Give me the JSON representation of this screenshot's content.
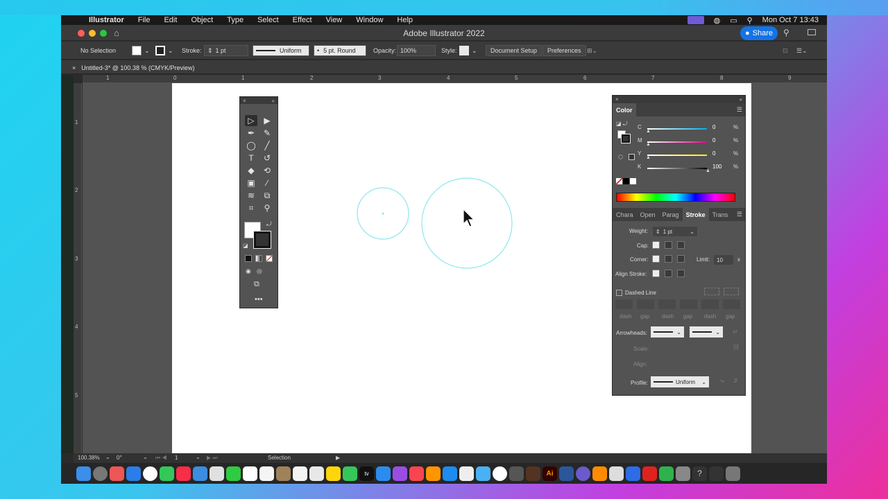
{
  "menubar": {
    "app": "Illustrator",
    "items": [
      "File",
      "Edit",
      "Object",
      "Type",
      "Select",
      "Effect",
      "View",
      "Window",
      "Help"
    ],
    "clock": "Mon Oct 7  13:43"
  },
  "window": {
    "title": "Adobe Illustrator 2022",
    "share": "Share"
  },
  "control": {
    "selection": "No Selection",
    "stroke_label": "Stroke:",
    "stroke_weight": "1 pt",
    "profile": "Uniform",
    "brush": "5 pt. Round",
    "opacity_label": "Opacity:",
    "opacity": "100%",
    "style_label": "Style:",
    "doc_setup": "Document Setup",
    "preferences": "Preferences"
  },
  "doc_tab": {
    "close": "×",
    "title": "Untitled-3* @ 100.38 % (CMYK/Preview)"
  },
  "ruler_h": [
    "1",
    "0",
    "1",
    "2",
    "3",
    "4",
    "5",
    "6",
    "7",
    "8",
    "9"
  ],
  "ruler_v": [
    "1",
    "2",
    "3",
    "4",
    "5"
  ],
  "status": {
    "zoom": "100.38%",
    "rotation": "0°",
    "artboard": "1",
    "tool": "Selection"
  },
  "color_panel": {
    "title": "Color",
    "channels": [
      {
        "label": "C",
        "value": "0",
        "unit": "%",
        "level": 0
      },
      {
        "label": "M",
        "value": "0",
        "unit": "%",
        "level": 0
      },
      {
        "label": "Y",
        "value": "0",
        "unit": "%",
        "level": 0
      },
      {
        "label": "K",
        "value": "100",
        "unit": "%",
        "level": 1
      }
    ]
  },
  "stroke_panel": {
    "tabs": [
      "Chara",
      "Open",
      "Parag",
      "Stroke",
      "Trans"
    ],
    "active_tab": "Stroke",
    "weight_label": "Weight:",
    "weight": "1 pt",
    "cap_label": "Cap:",
    "corner_label": "Corner:",
    "limit_label": "Limit:",
    "limit": "10",
    "limit_unit": "x",
    "align_label": "Align Stroke:",
    "dashed_label": "Dashed Line",
    "dash_labels": [
      "dash",
      "gap",
      "dash",
      "gap",
      "dash",
      "gap"
    ],
    "arrowheads_label": "Arrowheads:",
    "scale_label": "Scale:",
    "align2_label": "Align:",
    "profile_label": "Profile:",
    "profile": "Uniform"
  },
  "colors": {
    "accent": "#1473e6",
    "circle_stroke": "#7fe3ec"
  }
}
